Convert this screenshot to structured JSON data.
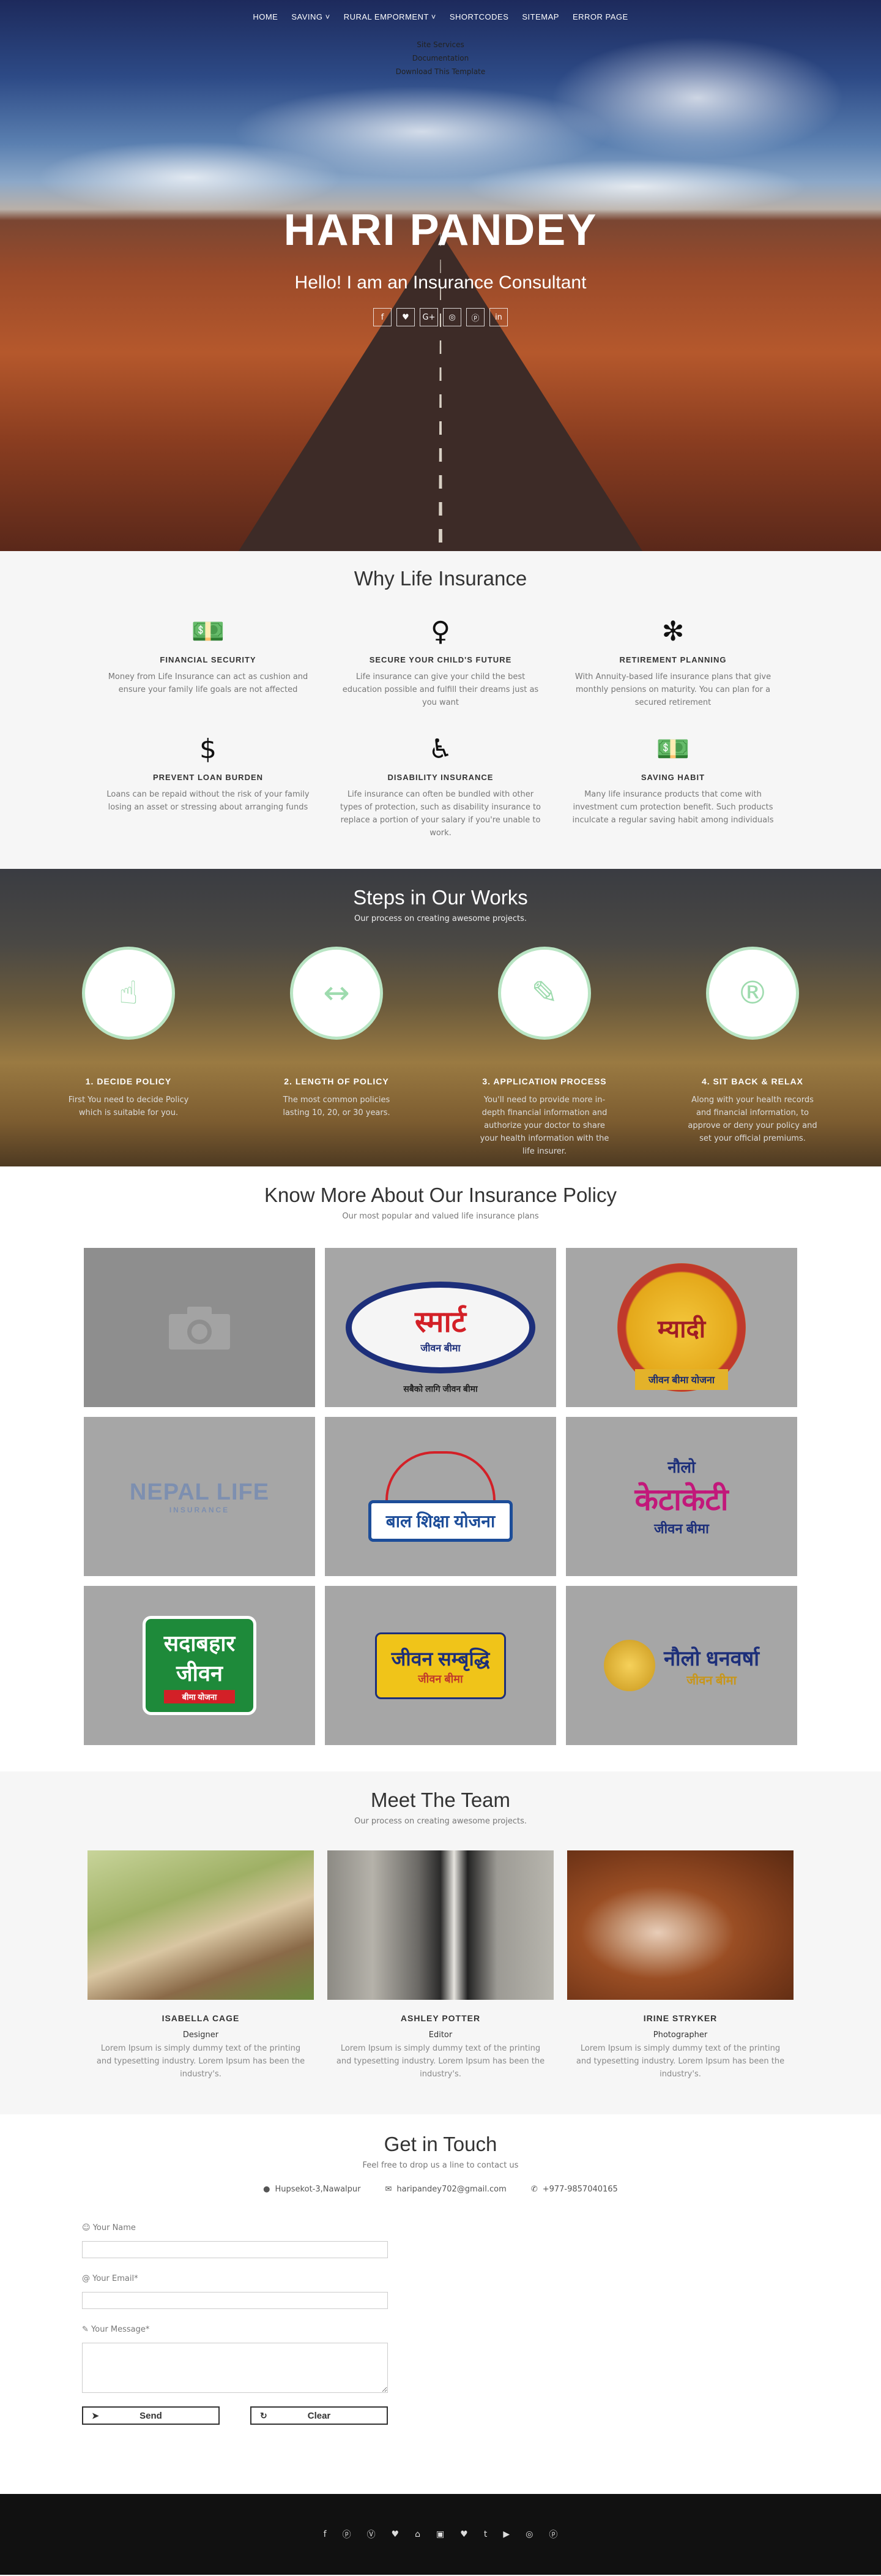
{
  "nav": {
    "items": [
      "HOME",
      "SAVING ˅",
      "RURAL EMPORMENT ˅",
      "SHORTCODES",
      "SITEMAP",
      "ERROR PAGE"
    ],
    "submenu": [
      "Site Services",
      "Documentation",
      "Download This Template"
    ]
  },
  "hero": {
    "title": "HARI PANDEY",
    "subtitle": "Hello! I am an Insurance Consultant",
    "social": [
      "f",
      "♥",
      "G+",
      "◎",
      "ⓟ",
      "in"
    ]
  },
  "why": {
    "title": "Why Life Insurance",
    "items": [
      {
        "icon": "money-icon",
        "glyph": "💵",
        "title": "FINANCIAL SECURITY",
        "text": "Money from Life Insurance can act as cushion and ensure your family life goals are not affected"
      },
      {
        "icon": "user-icon",
        "glyph": "♀",
        "title": "SECURE YOUR CHILD'S FUTURE",
        "text": "Life insurance can give your child the best education possible and fulfill their dreams just as you want"
      },
      {
        "icon": "asterisk-icon",
        "glyph": "✻",
        "title": "RETIREMENT PLANNING",
        "text": "With Annuity-based life insurance plans that give monthly pensions on maturity. You can plan for a secured retirement"
      },
      {
        "icon": "dollar-icon",
        "glyph": "$",
        "title": "PREVENT LOAN BURDEN",
        "text": "Loans can be repaid without the risk of your family losing an asset or stressing about arranging funds"
      },
      {
        "icon": "wheelchair-icon",
        "glyph": "♿",
        "title": "DISABILITY INSURANCE",
        "text": "Life insurance can often be bundled with other types of protection, such as disability insurance to replace a portion of your salary if you're unable to work."
      },
      {
        "icon": "money-icon",
        "glyph": "💵",
        "title": "SAVING HABIT",
        "text": "Many life insurance products that come with investment cum protection benefit. Such products inculcate a regular saving habit among individuals"
      }
    ]
  },
  "steps": {
    "title": "Steps in Our Works",
    "subtitle": "Our process on creating awesome projects.",
    "items": [
      {
        "icon": "hand-pointer-icon",
        "glyph": "☝",
        "title": "1. DECIDE POLICY",
        "text": "First You need to decide Policy which is suitable for you."
      },
      {
        "icon": "arrows-horizontal-icon",
        "glyph": "↔",
        "title": "2. LENGTH OF POLICY",
        "text": "The most common policies lasting 10, 20, or 30 years."
      },
      {
        "icon": "edit-icon",
        "glyph": "✎",
        "title": "3. APPLICATION PROCESS",
        "text": "You'll need to provide more in-depth financial information and authorize your doctor to share your health information with the life insurer."
      },
      {
        "icon": "registered-icon",
        "glyph": "®",
        "title": "4. SIT BACK & RELAX",
        "text": "Along with your health records and financial information, to approve or deny your policy and set your official premiums."
      }
    ]
  },
  "policy": {
    "title": "Know More About Our Insurance Policy",
    "subtitle": "Our most popular and valued life insurance plans",
    "tiles": [
      {
        "name": "camera-placeholder",
        "line1": "",
        "line2": "",
        "line3": ""
      },
      {
        "name": "smart-jeevan-bima",
        "line1": "स्मार्ट",
        "line2": "जीवन बीमा",
        "line3": "सबैको लागि जीवन बीमा"
      },
      {
        "name": "myadi-jeevan-bima",
        "line1": "म्यादी",
        "line2": "जीवन बीमा योजना",
        "line3": ""
      },
      {
        "name": "nepal-life-logo",
        "line1": "NEPAL LIFE",
        "line2": "INSURANCE",
        "line3": ""
      },
      {
        "name": "bal-shiksha-yojana",
        "line1": "बाल शिक्षा योजना",
        "line2": "",
        "line3": ""
      },
      {
        "name": "naulo-ketaketi",
        "line1": "नौलो",
        "line2": "केटाकेटी",
        "line3": "जीवन बीमा"
      },
      {
        "name": "sadabahar-jeevan",
        "line1": "सदाबहार",
        "line2": "जीवन",
        "line3": "बीमा योजना"
      },
      {
        "name": "jeevan-samriddhi",
        "line1": "जीवन सम्बृद्धि",
        "line2": "जीवन बीमा",
        "line3": ""
      },
      {
        "name": "naulo-dhanbarsha",
        "line1": "नौलो धनवर्षा",
        "line2": "जीवन बीमा",
        "line3": ""
      }
    ]
  },
  "team": {
    "title": "Meet The Team",
    "subtitle": "Our process on creating awesome projects.",
    "members": [
      {
        "name": "ISABELLA CAGE",
        "role": "Designer",
        "text": "Lorem Ipsum is simply dummy text of the printing and typesetting industry. Lorem Ipsum has been the industry's."
      },
      {
        "name": "ASHLEY POTTER",
        "role": "Editor",
        "text": "Lorem Ipsum is simply dummy text of the printing and typesetting industry. Lorem Ipsum has been the industry's."
      },
      {
        "name": "IRINE STRYKER",
        "role": "Photographer",
        "text": "Lorem Ipsum is simply dummy text of the printing and typesetting industry. Lorem Ipsum has been the industry's."
      }
    ]
  },
  "contact": {
    "title": "Get in Touch",
    "subtitle": "Feel free to drop us a line to contact us",
    "address": "Hupsekot-3,Nawalpur",
    "email": "haripandey702@gmail.com",
    "phone": "+977-9857040165",
    "name_label": "Your Name",
    "email_label": "Your Email*",
    "message_label": "Your Message*",
    "send": "Send",
    "clear": "Clear"
  },
  "footer": {
    "icons": [
      "f",
      "ⓟ",
      "Ⓥ",
      "♥",
      "⌂",
      "▣",
      "♥",
      "t",
      "▶",
      "◎",
      "ⓟ"
    ]
  },
  "colors": {
    "accent": "#9edbae",
    "footer": "#111111",
    "section": "#f6f6f6"
  }
}
